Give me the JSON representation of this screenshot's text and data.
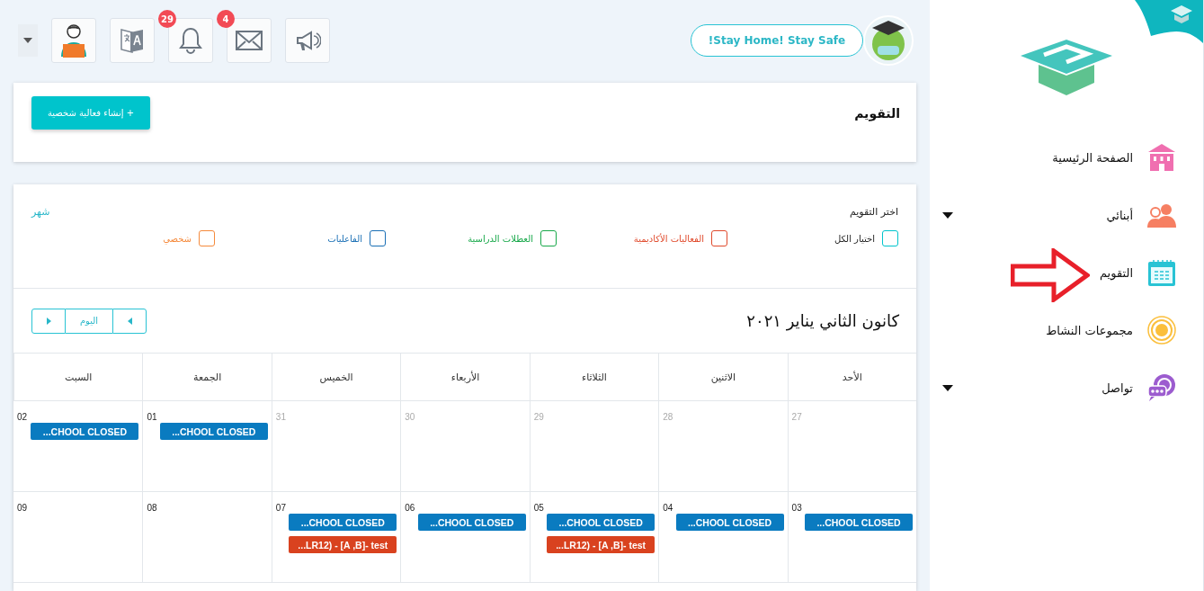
{
  "header": {
    "status_message": "!Stay Home! Stay Safe",
    "toolbar": [
      {
        "kind": "announcements"
      },
      {
        "kind": "mail",
        "badge": "4"
      },
      {
        "kind": "notifications",
        "badge": "29"
      },
      {
        "kind": "translate"
      },
      {
        "kind": "profile"
      }
    ]
  },
  "page": {
    "title": "التقويم",
    "create_button": "+ إنشاء فعالية شخصية"
  },
  "filters": {
    "heading": "اختر التقويم",
    "view": "شهر",
    "items": [
      {
        "label": "اختيار الكل",
        "color": "#00c4cc",
        "checked": false
      },
      {
        "label": "الفعاليات الأكاديمية",
        "color": "#e04a2c",
        "checked": false
      },
      {
        "label": "العطلات الدراسية",
        "color": "#18a84a",
        "checked": false
      },
      {
        "label": "الفاعليات",
        "color": "#1a6fb5",
        "checked": false
      },
      {
        "label": "شخصي",
        "color": "#f58a3c",
        "checked": false
      }
    ]
  },
  "calendar": {
    "title": "كانون الثاني يناير ٢٠٢١",
    "today": "اليوم",
    "weekdays": [
      "الأحد",
      "الاثنين",
      "الثلاثاء",
      "الأربعاء",
      "الخميس",
      "الجمعة",
      "السبت"
    ],
    "weeks": [
      [
        {
          "day": "27",
          "outside": true
        },
        {
          "day": "28",
          "outside": true
        },
        {
          "day": "29",
          "outside": true
        },
        {
          "day": "30",
          "outside": true
        },
        {
          "day": "31",
          "outside": true
        },
        {
          "day": "01",
          "outside": false,
          "events": [
            {
              "label": "...CHOOL CLOSED",
              "color": "#0a7bc0"
            }
          ]
        },
        {
          "day": "02",
          "outside": false,
          "events": [
            {
              "label": "...CHOOL CLOSED",
              "color": "#0a7bc0"
            }
          ]
        }
      ],
      [
        {
          "day": "03",
          "outside": false,
          "events": [
            {
              "label": "...CHOOL CLOSED",
              "color": "#0a7bc0"
            }
          ]
        },
        {
          "day": "04",
          "outside": false,
          "events": [
            {
              "label": "...CHOOL CLOSED",
              "color": "#0a7bc0"
            }
          ]
        },
        {
          "day": "05",
          "outside": false,
          "events": [
            {
              "label": "...CHOOL CLOSED",
              "color": "#0a7bc0"
            },
            {
              "label": "...LR12) - [A ,B]- test",
              "color": "#d9421f"
            }
          ]
        },
        {
          "day": "06",
          "outside": false,
          "events": [
            {
              "label": "...CHOOL CLOSED",
              "color": "#0a7bc0"
            }
          ]
        },
        {
          "day": "07",
          "outside": false,
          "events": [
            {
              "label": "...CHOOL CLOSED",
              "color": "#0a7bc0"
            },
            {
              "label": "...LR12) - [A ,B]- test",
              "color": "#d9421f"
            }
          ]
        },
        {
          "day": "08",
          "outside": false
        },
        {
          "day": "09",
          "outside": false
        }
      ]
    ]
  },
  "sidebar": {
    "items": [
      {
        "label": "الصفحة الرئيسية",
        "has_submenu": false
      },
      {
        "label": "أبنائي",
        "has_submenu": true
      },
      {
        "label": "التقويم",
        "has_submenu": false
      },
      {
        "label": "مجموعات النشاط",
        "has_submenu": false
      },
      {
        "label": "تواصل",
        "has_submenu": true
      }
    ]
  }
}
